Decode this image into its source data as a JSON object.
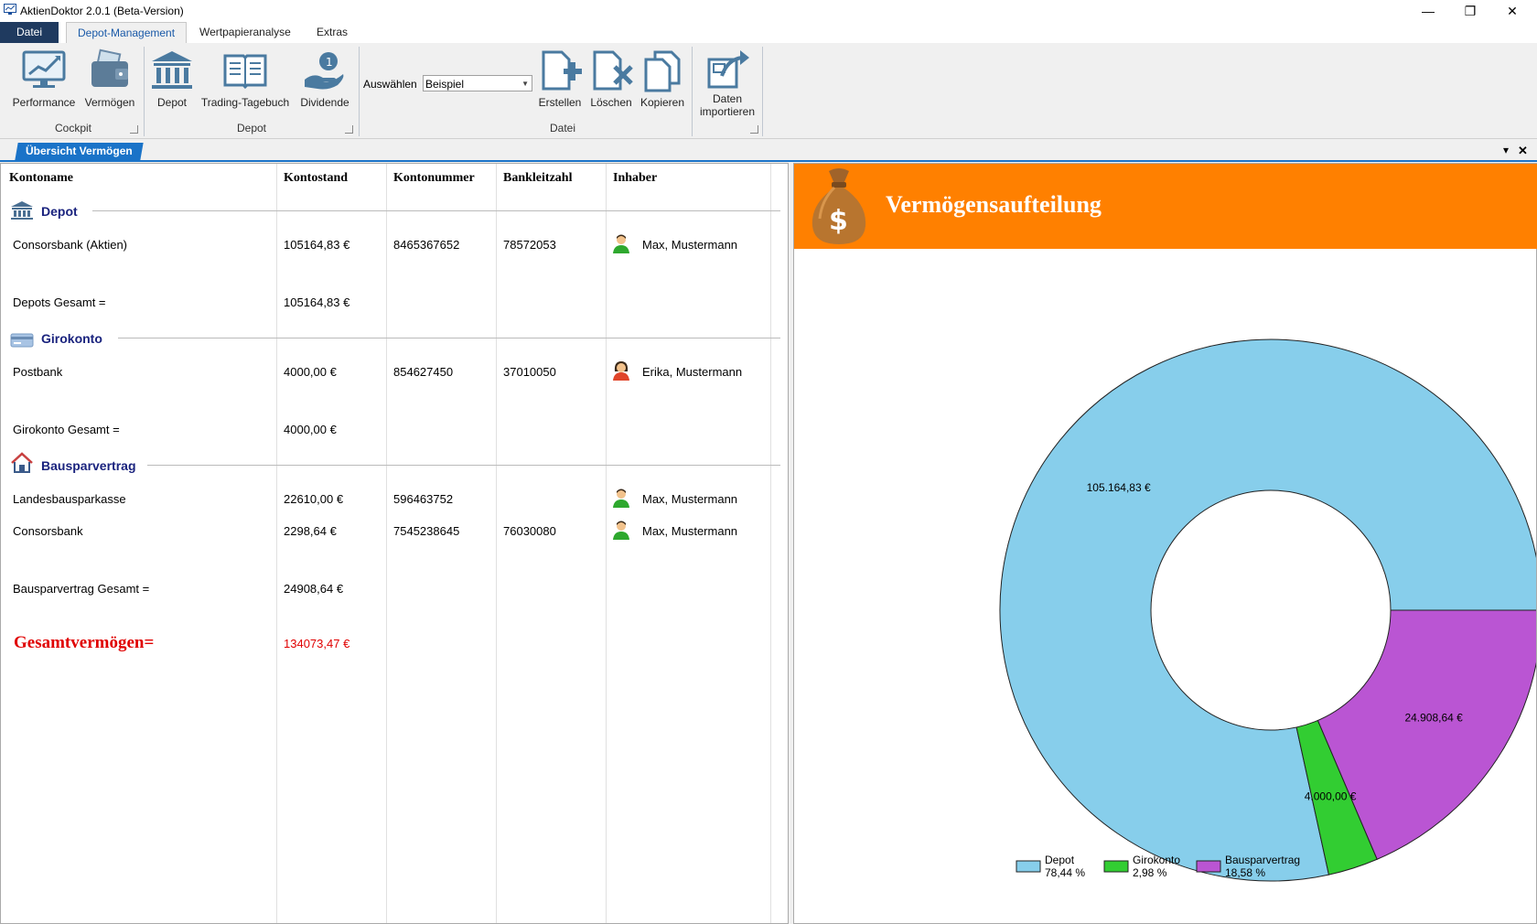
{
  "window": {
    "title": "AktienDoktor 2.0.1 (Beta-Version)",
    "controls": {
      "minimize": "—",
      "restore": "❐",
      "close": "✕"
    }
  },
  "ribbon_tabs": [
    "Datei",
    "Depot-Management",
    "Wertpapieranalyse",
    "Extras"
  ],
  "ribbon": {
    "groups": {
      "cockpit": {
        "label": "Cockpit",
        "buttons": [
          "Performance",
          "Vermögen"
        ]
      },
      "depot": {
        "label": "Depot",
        "buttons": [
          "Depot",
          "Trading-Tagebuch",
          "Dividende"
        ]
      },
      "datei": {
        "label": "Datei",
        "select_label": "Auswählen",
        "select_value": "Beispiel",
        "buttons": [
          "Erstellen",
          "Löschen",
          "Kopieren"
        ],
        "import_line1": "Daten",
        "import_line2": "importieren"
      }
    }
  },
  "doc_tab": {
    "label": "Übersicht Vermögen",
    "menu_icon": "▾",
    "close_icon": "✕"
  },
  "table": {
    "headers": [
      "Kontoname",
      "Kontostand",
      "Kontonummer",
      "Bankleitzahl",
      "Inhaber"
    ],
    "sections": [
      {
        "title": "Depot",
        "rows": [
          {
            "name": "Consorsbank (Aktien)",
            "balance": "105164,83 €",
            "number": "8465367652",
            "blz": "78572053",
            "owner": "Max, Mustermann",
            "owner_icon": "male-user-icon"
          }
        ],
        "total_label": "Depots Gesamt =",
        "total_value": "105164,83 €"
      },
      {
        "title": "Girokonto",
        "rows": [
          {
            "name": "Postbank",
            "balance": "4000,00 €",
            "number": "854627450",
            "blz": "37010050",
            "owner": "Erika, Mustermann",
            "owner_icon": "female-user-icon"
          }
        ],
        "total_label": "Girokonto Gesamt =",
        "total_value": "4000,00 €"
      },
      {
        "title": "Bausparvertrag",
        "rows": [
          {
            "name": "Landesbausparkasse",
            "balance": "22610,00 €",
            "number": "596463752",
            "blz": "",
            "owner": "Max, Mustermann",
            "owner_icon": "male-user-icon"
          },
          {
            "name": "Consorsbank",
            "balance": "2298,64 €",
            "number": "7545238645",
            "blz": "76030080",
            "owner": "Max, Mustermann",
            "owner_icon": "male-user-icon"
          }
        ],
        "total_label": "Bausparvertrag Gesamt =",
        "total_value": "24908,64 €"
      }
    ],
    "grand_total_label": "Gesamtvermögen=",
    "grand_total_value": "134073,47 €",
    "grand_total_color": "#e00000"
  },
  "banner": {
    "title": "Vermögensaufteilung",
    "color": "#ff8000",
    "icon": "money-bag-icon"
  },
  "chart_data": {
    "type": "pie",
    "variant": "donut",
    "categories": [
      "Depot",
      "Girokonto",
      "Bausparvertrag"
    ],
    "values": [
      105164.83,
      4000.0,
      24908.64
    ],
    "value_labels": [
      "105.164,83 €",
      "4.000,00 €",
      "24.908,64 €"
    ],
    "percent_labels": [
      "78,44 %",
      "2,98 %",
      "18,58 %"
    ],
    "colors": [
      "#87ceeb",
      "#32cd32",
      "#ba55d3"
    ],
    "legend_position": "bottom-center"
  }
}
